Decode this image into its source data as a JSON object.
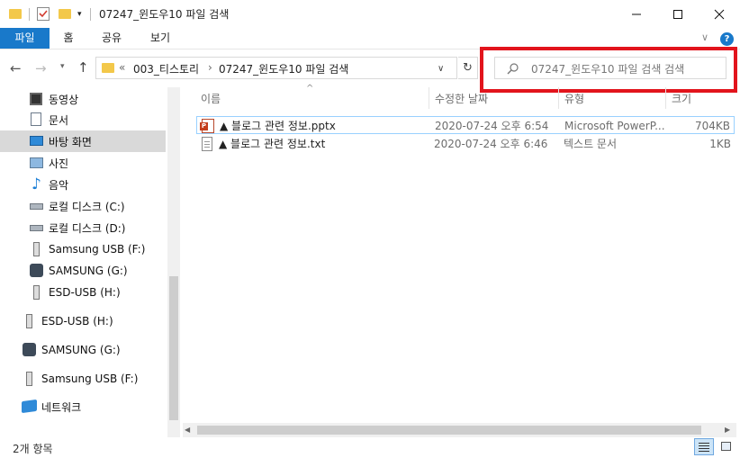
{
  "window": {
    "title": "07247_윈도우10 파일 검색"
  },
  "ribbon": {
    "tabs": [
      "파일",
      "홈",
      "공유",
      "보기"
    ],
    "accent": "#1979ca"
  },
  "address": {
    "path_prefix": "«",
    "segments": [
      "003_티스토리",
      "07247_윈도우10 파일 검색"
    ],
    "chevron": "›"
  },
  "search": {
    "placeholder": "07247_윈도우10 파일 검색 검색",
    "highlight_color": "#e2141c"
  },
  "nav": {
    "items": [
      {
        "label": "동영상",
        "icon": "video-icon"
      },
      {
        "label": "문서",
        "icon": "document-icon"
      },
      {
        "label": "바탕 화면",
        "icon": "desktop-icon",
        "selected": true
      },
      {
        "label": "사진",
        "icon": "pictures-icon"
      },
      {
        "label": "음악",
        "icon": "music-icon"
      },
      {
        "label": "로컬 디스크 (C:)",
        "icon": "drive-c-icon"
      },
      {
        "label": "로컬 디스크 (D:)",
        "icon": "drive-d-icon"
      },
      {
        "label": "Samsung USB (F:)",
        "icon": "usb-icon"
      },
      {
        "label": "SAMSUNG (G:)",
        "icon": "disc-drive-icon"
      },
      {
        "label": "ESD-USB (H:)",
        "icon": "usb-icon"
      }
    ],
    "roots": [
      {
        "label": "ESD-USB (H:)",
        "icon": "usb-icon"
      },
      {
        "label": "SAMSUNG (G:)",
        "icon": "disc-drive-icon"
      },
      {
        "label": "Samsung USB (F:)",
        "icon": "usb-icon"
      },
      {
        "label": "네트워크",
        "icon": "network-icon"
      }
    ]
  },
  "columns": {
    "name": "이름",
    "date": "수정한 날짜",
    "type": "유형",
    "size": "크기",
    "sort_glyph": "^"
  },
  "files": [
    {
      "name": "▲ 블로그 관련 정보.pptx",
      "date": "2020-07-24 오후 6:54",
      "type": "Microsoft PowerP...",
      "size": "704KB",
      "icon": "powerpoint-file-icon"
    },
    {
      "name": "▲ 블로그 관련 정보.txt",
      "date": "2020-07-24 오후 6:46",
      "type": "텍스트 문서",
      "size": "1KB",
      "icon": "text-file-icon"
    }
  ],
  "status": {
    "count": "2개 항목"
  }
}
